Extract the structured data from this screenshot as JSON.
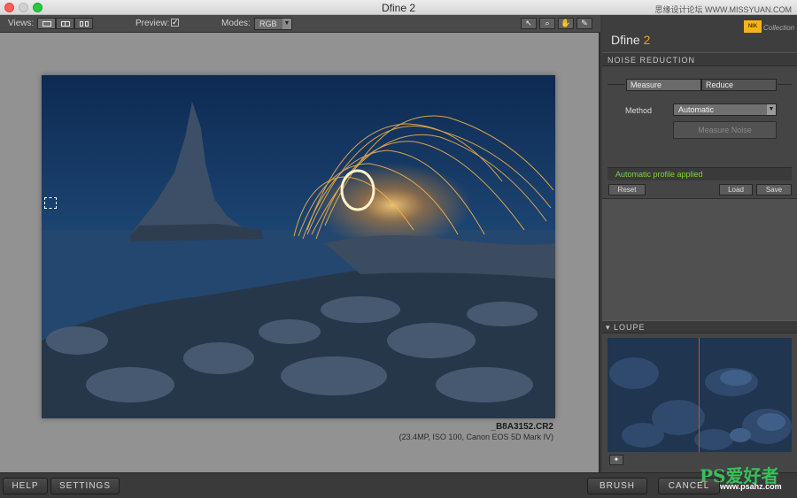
{
  "window": {
    "title": "Dfine 2",
    "watermark": "思缘设计论坛 WWW.MISSYUAN.COM"
  },
  "toolbar": {
    "views_label": "Views:",
    "preview_label": "Preview:",
    "preview_checked": true,
    "modes_label": "Modes:",
    "mode_value": "RGB",
    "tool_icons": [
      "zoom-arrow-icon",
      "magnifier-icon",
      "hand-icon",
      "eyedropper-icon"
    ]
  },
  "image": {
    "filename": "_B8A3152.CR2",
    "info": "(23.4MP, ISO 100, Canon EOS 5D Mark IV)"
  },
  "panel": {
    "brand": "Dfine",
    "brand_version": "2",
    "nik_badge": "NIK",
    "nik_collection": "Collection",
    "section_title": "NOISE REDUCTION",
    "tabs": [
      "Measure",
      "Reduce"
    ],
    "method_label": "Method",
    "method_value": "Automatic",
    "measure_noise": "Measure Noise",
    "status": "Automatic profile applied",
    "reset": "Reset",
    "load": "Load",
    "save": "Save",
    "loupe_title": "LOUPE",
    "accent_color": "#f0a11a",
    "status_color": "#7ed43a"
  },
  "bottom": {
    "help": "HELP",
    "settings": "SETTINGS",
    "brush": "BRUSH",
    "cancel": "CANCEL",
    "watermark": "PS爱好者",
    "watermark_url": "www.psahz.com"
  }
}
